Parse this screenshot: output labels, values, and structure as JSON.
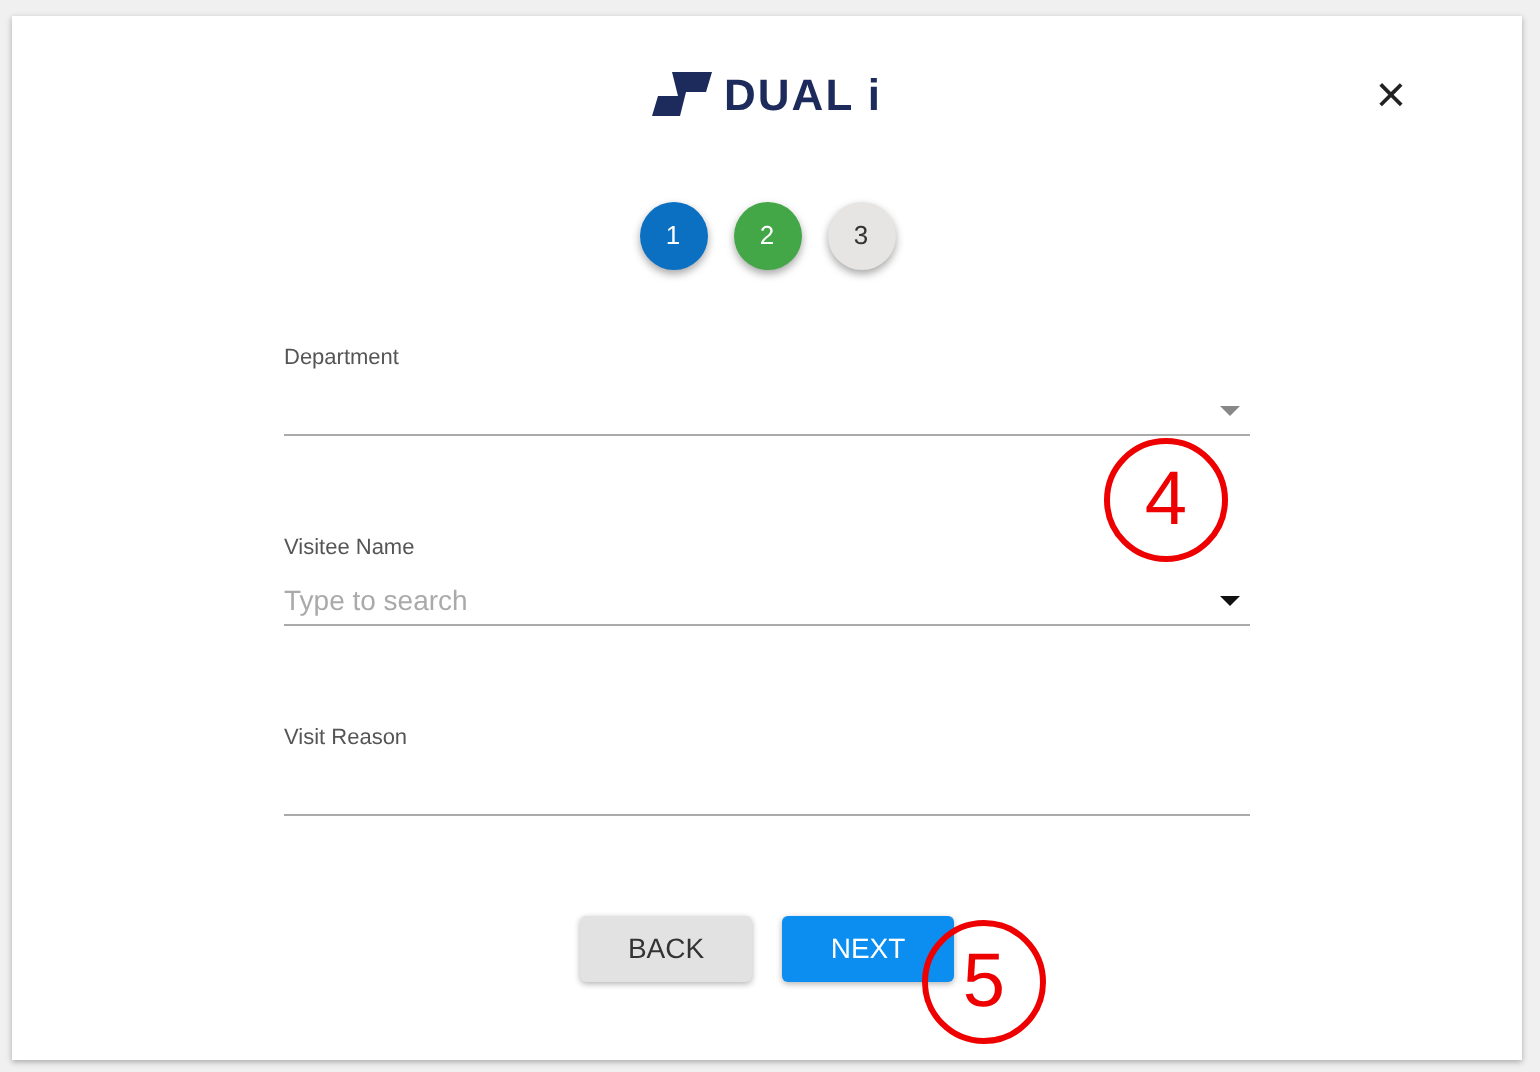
{
  "logo": {
    "text": "DUAL i"
  },
  "close": {
    "label": "×"
  },
  "steps": [
    {
      "label": "1",
      "color": "#0b6fc2"
    },
    {
      "label": "2",
      "color": "#43a647"
    },
    {
      "label": "3",
      "color": "#e6e5e3"
    }
  ],
  "fields": [
    {
      "kind": "select",
      "label": "Department",
      "disabled": true
    },
    {
      "kind": "select",
      "label": "Visitee Name",
      "placeholder": "Type to search",
      "disabled": false
    },
    {
      "kind": "text",
      "label": "Visit Reason"
    }
  ],
  "buttons": [
    {
      "label": "BACK",
      "kind": "secondary"
    },
    {
      "label": "NEXT",
      "kind": "primary"
    }
  ],
  "callouts": [
    {
      "label": "4"
    },
    {
      "label": "5"
    }
  ]
}
